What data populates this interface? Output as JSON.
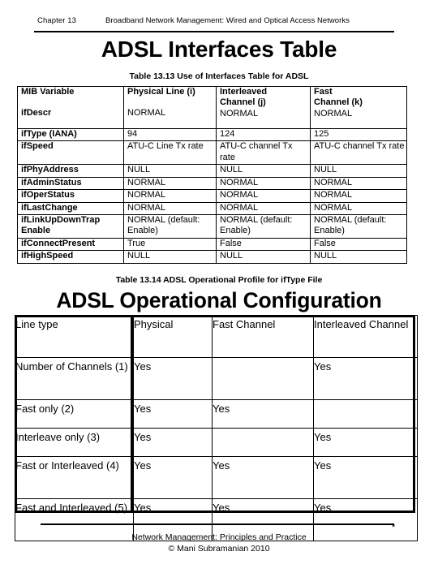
{
  "header": {
    "chapter": "Chapter 13",
    "subject": "Broadband Network Management:  Wired and Optical Access Networks"
  },
  "titles": {
    "interfaces": "ADSL Interfaces Table",
    "operational": "ADSL Operational Configuration"
  },
  "captions": {
    "interfaces": "Table 13.13  Use of Interfaces Table for ADSL",
    "operational": "Table 13.14  ADSL Operational Profile for ifType File"
  },
  "interfaces_table": {
    "headers": [
      "MIB Variable",
      "Physical Line (i)",
      "Interleaved Channel (j)",
      "Fast Channel (k)"
    ],
    "header_lines": [
      [
        "MIB Variable"
      ],
      [
        "Physical Line (i)"
      ],
      [
        "Interleaved",
        "Channel (j)"
      ],
      [
        "Fast",
        "Channel (k)"
      ]
    ],
    "header_row_values": [
      "ifDescr",
      "NORMAL",
      "NORMAL",
      "NORMAL"
    ],
    "rows": [
      {
        "variable": "ifType (IANA)",
        "physical_line": "94",
        "interleaved_channel": "124",
        "fast_channel": "125"
      },
      {
        "variable": "ifSpeed",
        "physical_line": "ATU-C Line Tx rate",
        "interleaved_channel": "ATU-C channel Tx rate",
        "fast_channel": "ATU-C channel Tx rate"
      },
      {
        "variable": "ifPhyAddress",
        "physical_line": "NULL",
        "interleaved_channel": "NULL",
        "fast_channel": "NULL"
      },
      {
        "variable": "ifAdminStatus",
        "physical_line": "NORMAL",
        "interleaved_channel": "NORMAL",
        "fast_channel": "NORMAL"
      },
      {
        "variable": "ifOperStatus",
        "physical_line": "NORMAL",
        "interleaved_channel": "NORMAL",
        "fast_channel": "NORMAL"
      },
      {
        "variable": "ifLastChange",
        "physical_line": "NORMAL",
        "interleaved_channel": "NORMAL",
        "fast_channel": "NORMAL"
      },
      {
        "variable": "ifLinkUpDownTrap Enable",
        "physical_line": "NORMAL (default: Enable)",
        "interleaved_channel": "NORMAL (default: Enable)",
        "fast_channel": "NORMAL (default: Enable)"
      },
      {
        "variable": "ifConnectPresent",
        "physical_line": "True",
        "interleaved_channel": "False",
        "fast_channel": "False"
      },
      {
        "variable": "ifHighSpeed",
        "physical_line": "NULL",
        "interleaved_channel": "NULL",
        "fast_channel": "NULL"
      }
    ]
  },
  "operational_table": {
    "headers": [
      "Line type",
      "Physical",
      "Fast Channel",
      "Interleaved Channel"
    ],
    "rows": [
      {
        "line_type": "Number of Channels (1)",
        "physical": "Yes",
        "fast_channel": "",
        "interleaved_channel": "Yes"
      },
      {
        "line_type": "Fast only (2)",
        "physical": "Yes",
        "fast_channel": "Yes",
        "interleaved_channel": ""
      },
      {
        "line_type": "Interleave only (3)",
        "physical": "Yes",
        "fast_channel": "",
        "interleaved_channel": "Yes"
      },
      {
        "line_type": "Fast or Interleaved (4)",
        "physical": "Yes",
        "fast_channel": "Yes",
        "interleaved_channel": "Yes"
      },
      {
        "line_type": "Fast and Interleaved (5)",
        "physical": "Yes",
        "fast_channel": "Yes",
        "interleaved_channel": "Yes"
      }
    ]
  },
  "footer": {
    "line1": "Network Management: Principles and Practice",
    "line2": "©  Mani Subramanian 2010",
    "asterisk": "*"
  }
}
